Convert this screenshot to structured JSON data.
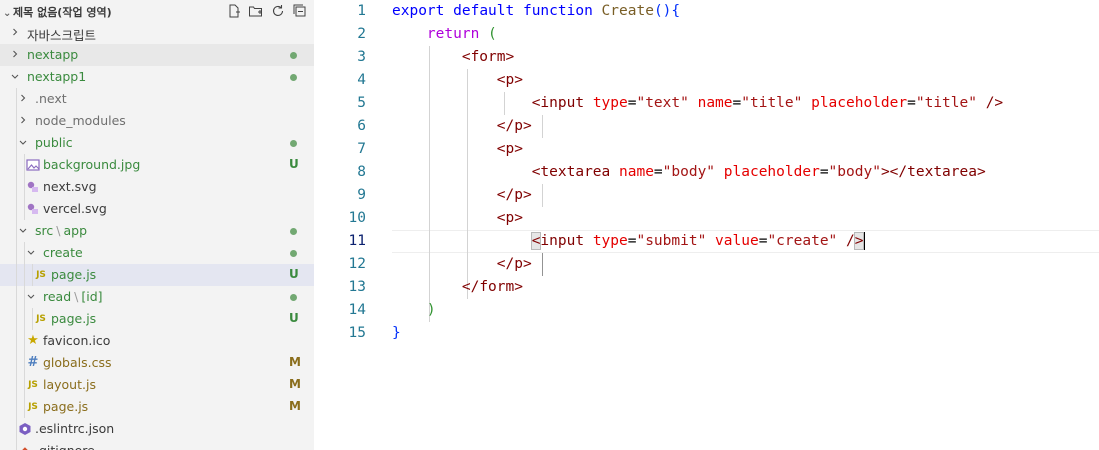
{
  "explorer": {
    "title": "제목 없음(작업 영역)",
    "actions": [
      "new-file-icon",
      "new-folder-icon",
      "refresh-icon",
      "collapse-all-icon"
    ],
    "items": [
      {
        "label": "자바스크립트",
        "type": "folder",
        "open": false,
        "depth": 0,
        "status": ""
      },
      {
        "label": "nextapp",
        "type": "folder",
        "open": false,
        "depth": 0,
        "status": "dot"
      },
      {
        "label": "nextapp1",
        "type": "folder",
        "open": true,
        "depth": 0,
        "status": "dot"
      },
      {
        "label": ".next",
        "type": "folder",
        "open": false,
        "depth": 1,
        "status": ""
      },
      {
        "label": "node_modules",
        "type": "folder",
        "open": false,
        "depth": 1,
        "status": ""
      },
      {
        "label": "public",
        "type": "folder",
        "open": true,
        "depth": 1,
        "status": "dot"
      },
      {
        "label": "background.jpg",
        "type": "file",
        "icon": "image-icon",
        "depth": 2,
        "status": "U"
      },
      {
        "label": "next.svg",
        "type": "file",
        "icon": "svg-icon",
        "depth": 2,
        "status": ""
      },
      {
        "label": "vercel.svg",
        "type": "file",
        "icon": "svg-icon",
        "depth": 2,
        "status": ""
      },
      {
        "label": "src",
        "label2": "app",
        "type": "folder",
        "open": true,
        "depth": 1,
        "status": "dot"
      },
      {
        "label": "create",
        "type": "folder",
        "open": true,
        "depth": 2,
        "status": "dot"
      },
      {
        "label": "page.js",
        "type": "file",
        "icon": "js-icon",
        "depth": 3,
        "status": "U"
      },
      {
        "label": "read",
        "label2": "[id]",
        "type": "folder",
        "open": true,
        "depth": 2,
        "status": "dot"
      },
      {
        "label": "page.js",
        "type": "file",
        "icon": "js-icon",
        "depth": 3,
        "status": "U"
      },
      {
        "label": "favicon.ico",
        "type": "file",
        "icon": "star-icon",
        "depth": 2,
        "status": ""
      },
      {
        "label": "globals.css",
        "type": "file",
        "icon": "hash-icon",
        "depth": 2,
        "status": "M"
      },
      {
        "label": "layout.js",
        "type": "file",
        "icon": "js-icon",
        "depth": 2,
        "status": "M"
      },
      {
        "label": "page.js",
        "type": "file",
        "icon": "js-icon",
        "depth": 2,
        "status": "M"
      },
      {
        "label": ".eslintrc.json",
        "type": "file",
        "icon": "eslint-icon",
        "depth": 1,
        "status": ""
      },
      {
        "label": ".gitignore",
        "type": "file",
        "icon": "git-icon",
        "depth": 1,
        "status": ""
      }
    ]
  },
  "editor": {
    "active_line": 11,
    "lines": [
      {
        "n": "1",
        "tokens": [
          [
            "kw",
            "export"
          ],
          [
            "plain",
            " "
          ],
          [
            "kw",
            "default"
          ],
          [
            "plain",
            " "
          ],
          [
            "kw",
            "function"
          ],
          [
            "plain",
            " "
          ],
          [
            "fn",
            "Create"
          ],
          [
            "brk1",
            "()"
          ],
          [
            "brk1",
            "{"
          ]
        ]
      },
      {
        "n": "2",
        "tokens": [
          [
            "plain",
            "    "
          ],
          [
            "ctl",
            "return"
          ],
          [
            "plain",
            " "
          ],
          [
            "brk2",
            "("
          ]
        ]
      },
      {
        "n": "3",
        "tokens": [
          [
            "plain",
            "        "
          ],
          [
            "pun",
            "<"
          ],
          [
            "tag",
            "form"
          ],
          [
            "pun",
            ">"
          ]
        ]
      },
      {
        "n": "4",
        "tokens": [
          [
            "plain",
            "            "
          ],
          [
            "pun",
            "<"
          ],
          [
            "tag",
            "p"
          ],
          [
            "pun",
            ">"
          ]
        ]
      },
      {
        "n": "5",
        "tokens": [
          [
            "plain",
            "                "
          ],
          [
            "pun",
            "<"
          ],
          [
            "tag",
            "input"
          ],
          [
            "plain",
            " "
          ],
          [
            "attr",
            "type"
          ],
          [
            "plain",
            "="
          ],
          [
            "str",
            "\"text\""
          ],
          [
            "plain",
            " "
          ],
          [
            "attr",
            "name"
          ],
          [
            "plain",
            "="
          ],
          [
            "str",
            "\"title\""
          ],
          [
            "plain",
            " "
          ],
          [
            "attr",
            "placeholder"
          ],
          [
            "plain",
            "="
          ],
          [
            "str",
            "\"title\""
          ],
          [
            "plain",
            " "
          ],
          [
            "pun",
            "/>"
          ]
        ]
      },
      {
        "n": "6",
        "tokens": [
          [
            "plain",
            "            "
          ],
          [
            "pun",
            "</"
          ],
          [
            "tag",
            "p"
          ],
          [
            "pun",
            ">"
          ]
        ]
      },
      {
        "n": "7",
        "tokens": [
          [
            "plain",
            "            "
          ],
          [
            "pun",
            "<"
          ],
          [
            "tag",
            "p"
          ],
          [
            "pun",
            ">"
          ]
        ]
      },
      {
        "n": "8",
        "tokens": [
          [
            "plain",
            "                "
          ],
          [
            "pun",
            "<"
          ],
          [
            "tag",
            "textarea"
          ],
          [
            "plain",
            " "
          ],
          [
            "attr",
            "name"
          ],
          [
            "plain",
            "="
          ],
          [
            "str",
            "\"body\""
          ],
          [
            "plain",
            " "
          ],
          [
            "attr",
            "placeholder"
          ],
          [
            "plain",
            "="
          ],
          [
            "str",
            "\"body\""
          ],
          [
            "pun",
            "></"
          ],
          [
            "tag",
            "textarea"
          ],
          [
            "pun",
            ">"
          ]
        ]
      },
      {
        "n": "9",
        "tokens": [
          [
            "plain",
            "            "
          ],
          [
            "pun",
            "</"
          ],
          [
            "tag",
            "p"
          ],
          [
            "pun",
            ">"
          ]
        ]
      },
      {
        "n": "10",
        "tokens": [
          [
            "plain",
            "            "
          ],
          [
            "pun",
            "<"
          ],
          [
            "tag",
            "p"
          ],
          [
            "pun",
            ">"
          ]
        ]
      },
      {
        "n": "11",
        "tokens": [
          [
            "plain",
            "                "
          ],
          [
            "hl",
            "<"
          ],
          [
            "tag",
            "input"
          ],
          [
            "plain",
            " "
          ],
          [
            "attr",
            "type"
          ],
          [
            "plain",
            "="
          ],
          [
            "str",
            "\"submit\""
          ],
          [
            "plain",
            " "
          ],
          [
            "attr",
            "value"
          ],
          [
            "plain",
            "="
          ],
          [
            "str",
            "\"create\""
          ],
          [
            "plain",
            " "
          ],
          [
            "pun",
            "/"
          ],
          [
            "hl",
            ">"
          ],
          [
            "cursor",
            ""
          ]
        ]
      },
      {
        "n": "12",
        "tokens": [
          [
            "plain",
            "            "
          ],
          [
            "pun",
            "</"
          ],
          [
            "tag",
            "p"
          ],
          [
            "pun",
            ">"
          ]
        ]
      },
      {
        "n": "13",
        "tokens": [
          [
            "plain",
            "        "
          ],
          [
            "pun",
            "</"
          ],
          [
            "tag",
            "form"
          ],
          [
            "pun",
            ">"
          ]
        ]
      },
      {
        "n": "14",
        "tokens": [
          [
            "plain",
            "    "
          ],
          [
            "brk2",
            ")"
          ]
        ]
      },
      {
        "n": "15",
        "tokens": [
          [
            "brk1",
            "}"
          ]
        ]
      }
    ]
  }
}
